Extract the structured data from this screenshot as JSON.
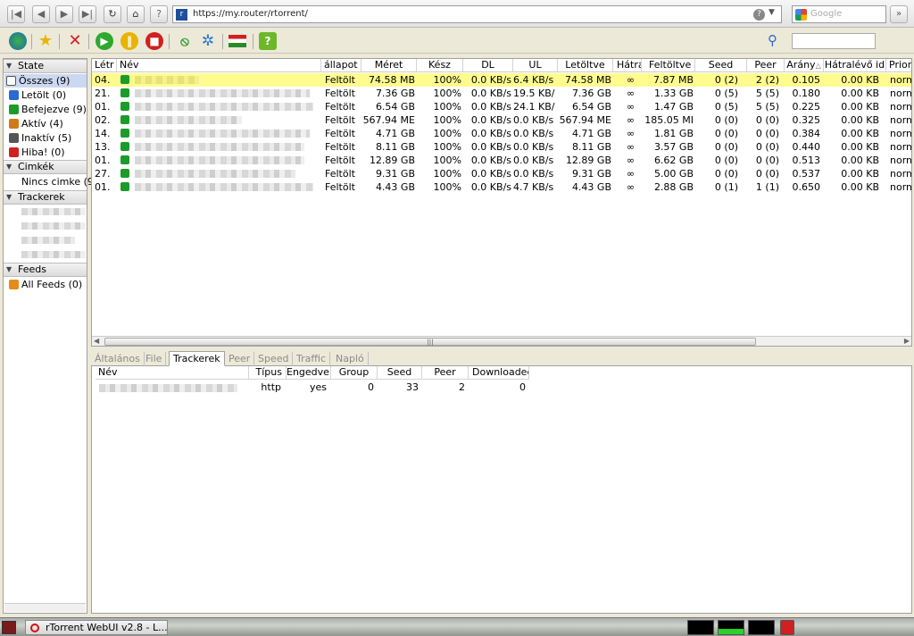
{
  "browser": {
    "url": "https://my.router/rtorrent/",
    "search_engine": "Google",
    "nav": [
      "first-icon",
      "back-icon",
      "forward-icon",
      "last-icon",
      "reload-icon",
      "home-icon",
      "info-icon"
    ]
  },
  "toolbar": {
    "icons": [
      "globe-icon",
      "star-icon",
      "delete-icon",
      "start-icon",
      "pause-icon",
      "stop-icon",
      "rss-icon",
      "settings-icon",
      "language-flag-icon",
      "help-icon"
    ],
    "search_value": ""
  },
  "sidebar": {
    "state_header": "State",
    "state_items": [
      {
        "label": "Összes (9)",
        "icon": "all-icon",
        "color": "#333333"
      },
      {
        "label": "Letölt (0)",
        "icon": "download-icon",
        "color": "#2a6ad3"
      },
      {
        "label": "Befejezve (9)",
        "icon": "complete-icon",
        "color": "#1b9b2a"
      },
      {
        "label": "Aktív (4)",
        "icon": "active-icon",
        "color": "#d07a1a"
      },
      {
        "label": "Inaktív (5)",
        "icon": "inactive-icon",
        "color": "#555555"
      },
      {
        "label": "Hiba! (0)",
        "icon": "error-icon",
        "color": "#d02020"
      }
    ],
    "labels_header": "Cimkék",
    "labels_items": [
      "Nincs cimke (9"
    ],
    "trackers_header": "Trackerek",
    "feeds_header": "Feeds",
    "feeds_items": [
      "All Feeds (0)"
    ]
  },
  "table": {
    "columns": [
      "Létr",
      "Név",
      "állapot",
      "Méret",
      "Kész",
      "DL",
      "UL",
      "Letöltve",
      "Hátra",
      "Feltöltve",
      "Seed",
      "Peer",
      "Arány",
      "Hátralévő id",
      "Priori"
    ],
    "rows": [
      {
        "date": "04.",
        "status": "Feltölt",
        "size": "74.58 MB",
        "done": "100%",
        "dl": "0.0 KB/s",
        "ul": "6.4 KB/s",
        "downloaded": "74.58 MB",
        "eta": "∞",
        "uploaded": "7.87 MB",
        "seed": "0 (2)",
        "peer": "2 (2)",
        "ratio": "0.105",
        "remaining": "0.00 KB",
        "prio": "norm"
      },
      {
        "date": "21.",
        "status": "Feltölt",
        "size": "7.36 GB",
        "done": "100%",
        "dl": "0.0 KB/s",
        "ul": "19.5 KB/",
        "downloaded": "7.36 GB",
        "eta": "∞",
        "uploaded": "1.33 GB",
        "seed": "0 (5)",
        "peer": "5 (5)",
        "ratio": "0.180",
        "remaining": "0.00 KB",
        "prio": "norm"
      },
      {
        "date": "01.",
        "status": "Feltölt",
        "size": "6.54 GB",
        "done": "100%",
        "dl": "0.0 KB/s",
        "ul": "24.1 KB/",
        "downloaded": "6.54 GB",
        "eta": "∞",
        "uploaded": "1.47 GB",
        "seed": "0 (5)",
        "peer": "5 (5)",
        "ratio": "0.225",
        "remaining": "0.00 KB",
        "prio": "norm"
      },
      {
        "date": "02.",
        "status": "Feltölt",
        "size": "567.94 ME",
        "done": "100%",
        "dl": "0.0 KB/s",
        "ul": "0.0 KB/s",
        "downloaded": "567.94 ME",
        "eta": "∞",
        "uploaded": "185.05 MI",
        "seed": "0 (0)",
        "peer": "0 (0)",
        "ratio": "0.325",
        "remaining": "0.00 KB",
        "prio": "norm"
      },
      {
        "date": "14.",
        "status": "Feltölt",
        "size": "4.71 GB",
        "done": "100%",
        "dl": "0.0 KB/s",
        "ul": "0.0 KB/s",
        "downloaded": "4.71 GB",
        "eta": "∞",
        "uploaded": "1.81 GB",
        "seed": "0 (0)",
        "peer": "0 (0)",
        "ratio": "0.384",
        "remaining": "0.00 KB",
        "prio": "norm"
      },
      {
        "date": "13.",
        "status": "Feltölt",
        "size": "8.11 GB",
        "done": "100%",
        "dl": "0.0 KB/s",
        "ul": "0.0 KB/s",
        "downloaded": "8.11 GB",
        "eta": "∞",
        "uploaded": "3.57 GB",
        "seed": "0 (0)",
        "peer": "0 (0)",
        "ratio": "0.440",
        "remaining": "0.00 KB",
        "prio": "norm"
      },
      {
        "date": "01.",
        "status": "Feltölt",
        "size": "12.89 GB",
        "done": "100%",
        "dl": "0.0 KB/s",
        "ul": "0.0 KB/s",
        "downloaded": "12.89 GB",
        "eta": "∞",
        "uploaded": "6.62 GB",
        "seed": "0 (0)",
        "peer": "0 (0)",
        "ratio": "0.513",
        "remaining": "0.00 KB",
        "prio": "norm"
      },
      {
        "date": "27.",
        "status": "Feltölt",
        "size": "9.31 GB",
        "done": "100%",
        "dl": "0.0 KB/s",
        "ul": "0.0 KB/s",
        "downloaded": "9.31 GB",
        "eta": "∞",
        "uploaded": "5.00 GB",
        "seed": "0 (0)",
        "peer": "0 (0)",
        "ratio": "0.537",
        "remaining": "0.00 KB",
        "prio": "norm"
      },
      {
        "date": "01.",
        "status": "Feltölt",
        "size": "4.43 GB",
        "done": "100%",
        "dl": "0.0 KB/s",
        "ul": "4.7 KB/s",
        "downloaded": "4.43 GB",
        "eta": "∞",
        "uploaded": "2.88 GB",
        "seed": "0 (1)",
        "peer": "1 (1)",
        "ratio": "0.650",
        "remaining": "0.00 KB",
        "prio": "norm"
      }
    ]
  },
  "detail_tabs": [
    {
      "label": "Általános",
      "active": false
    },
    {
      "label": "File",
      "active": false
    },
    {
      "label": "Trackerek",
      "active": true
    },
    {
      "label": "Peer",
      "active": false
    },
    {
      "label": "Speed",
      "active": false
    },
    {
      "label": "Traffic",
      "active": false
    },
    {
      "label": "Napló",
      "active": false
    }
  ],
  "trackers": {
    "columns": [
      "Név",
      "Típus",
      "Engedve",
      "Group",
      "Seed",
      "Peer",
      "Downloaded"
    ],
    "rows": [
      {
        "type": "http",
        "enabled": "yes",
        "group": "0",
        "seed": "33",
        "peer": "2",
        "downloaded": "0"
      }
    ]
  },
  "taskbar": {
    "window_title": "rTorrent WebUI v2.8 - L..."
  }
}
